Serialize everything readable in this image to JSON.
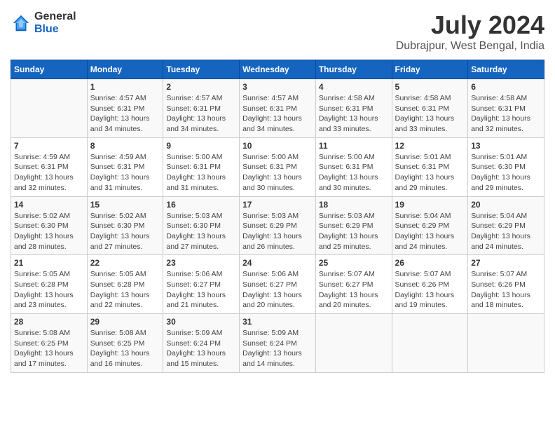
{
  "logo": {
    "general": "General",
    "blue": "Blue"
  },
  "title": "July 2024",
  "subtitle": "Dubrajpur, West Bengal, India",
  "weekdays": [
    "Sunday",
    "Monday",
    "Tuesday",
    "Wednesday",
    "Thursday",
    "Friday",
    "Saturday"
  ],
  "weeks": [
    [
      {
        "day": "",
        "info": ""
      },
      {
        "day": "1",
        "info": "Sunrise: 4:57 AM\nSunset: 6:31 PM\nDaylight: 13 hours\nand 34 minutes."
      },
      {
        "day": "2",
        "info": "Sunrise: 4:57 AM\nSunset: 6:31 PM\nDaylight: 13 hours\nand 34 minutes."
      },
      {
        "day": "3",
        "info": "Sunrise: 4:57 AM\nSunset: 6:31 PM\nDaylight: 13 hours\nand 34 minutes."
      },
      {
        "day": "4",
        "info": "Sunrise: 4:58 AM\nSunset: 6:31 PM\nDaylight: 13 hours\nand 33 minutes."
      },
      {
        "day": "5",
        "info": "Sunrise: 4:58 AM\nSunset: 6:31 PM\nDaylight: 13 hours\nand 33 minutes."
      },
      {
        "day": "6",
        "info": "Sunrise: 4:58 AM\nSunset: 6:31 PM\nDaylight: 13 hours\nand 32 minutes."
      }
    ],
    [
      {
        "day": "7",
        "info": "Sunrise: 4:59 AM\nSunset: 6:31 PM\nDaylight: 13 hours\nand 32 minutes."
      },
      {
        "day": "8",
        "info": "Sunrise: 4:59 AM\nSunset: 6:31 PM\nDaylight: 13 hours\nand 31 minutes."
      },
      {
        "day": "9",
        "info": "Sunrise: 5:00 AM\nSunset: 6:31 PM\nDaylight: 13 hours\nand 31 minutes."
      },
      {
        "day": "10",
        "info": "Sunrise: 5:00 AM\nSunset: 6:31 PM\nDaylight: 13 hours\nand 30 minutes."
      },
      {
        "day": "11",
        "info": "Sunrise: 5:00 AM\nSunset: 6:31 PM\nDaylight: 13 hours\nand 30 minutes."
      },
      {
        "day": "12",
        "info": "Sunrise: 5:01 AM\nSunset: 6:31 PM\nDaylight: 13 hours\nand 29 minutes."
      },
      {
        "day": "13",
        "info": "Sunrise: 5:01 AM\nSunset: 6:30 PM\nDaylight: 13 hours\nand 29 minutes."
      }
    ],
    [
      {
        "day": "14",
        "info": "Sunrise: 5:02 AM\nSunset: 6:30 PM\nDaylight: 13 hours\nand 28 minutes."
      },
      {
        "day": "15",
        "info": "Sunrise: 5:02 AM\nSunset: 6:30 PM\nDaylight: 13 hours\nand 27 minutes."
      },
      {
        "day": "16",
        "info": "Sunrise: 5:03 AM\nSunset: 6:30 PM\nDaylight: 13 hours\nand 27 minutes."
      },
      {
        "day": "17",
        "info": "Sunrise: 5:03 AM\nSunset: 6:29 PM\nDaylight: 13 hours\nand 26 minutes."
      },
      {
        "day": "18",
        "info": "Sunrise: 5:03 AM\nSunset: 6:29 PM\nDaylight: 13 hours\nand 25 minutes."
      },
      {
        "day": "19",
        "info": "Sunrise: 5:04 AM\nSunset: 6:29 PM\nDaylight: 13 hours\nand 24 minutes."
      },
      {
        "day": "20",
        "info": "Sunrise: 5:04 AM\nSunset: 6:29 PM\nDaylight: 13 hours\nand 24 minutes."
      }
    ],
    [
      {
        "day": "21",
        "info": "Sunrise: 5:05 AM\nSunset: 6:28 PM\nDaylight: 13 hours\nand 23 minutes."
      },
      {
        "day": "22",
        "info": "Sunrise: 5:05 AM\nSunset: 6:28 PM\nDaylight: 13 hours\nand 22 minutes."
      },
      {
        "day": "23",
        "info": "Sunrise: 5:06 AM\nSunset: 6:27 PM\nDaylight: 13 hours\nand 21 minutes."
      },
      {
        "day": "24",
        "info": "Sunrise: 5:06 AM\nSunset: 6:27 PM\nDaylight: 13 hours\nand 20 minutes."
      },
      {
        "day": "25",
        "info": "Sunrise: 5:07 AM\nSunset: 6:27 PM\nDaylight: 13 hours\nand 20 minutes."
      },
      {
        "day": "26",
        "info": "Sunrise: 5:07 AM\nSunset: 6:26 PM\nDaylight: 13 hours\nand 19 minutes."
      },
      {
        "day": "27",
        "info": "Sunrise: 5:07 AM\nSunset: 6:26 PM\nDaylight: 13 hours\nand 18 minutes."
      }
    ],
    [
      {
        "day": "28",
        "info": "Sunrise: 5:08 AM\nSunset: 6:25 PM\nDaylight: 13 hours\nand 17 minutes."
      },
      {
        "day": "29",
        "info": "Sunrise: 5:08 AM\nSunset: 6:25 PM\nDaylight: 13 hours\nand 16 minutes."
      },
      {
        "day": "30",
        "info": "Sunrise: 5:09 AM\nSunset: 6:24 PM\nDaylight: 13 hours\nand 15 minutes."
      },
      {
        "day": "31",
        "info": "Sunrise: 5:09 AM\nSunset: 6:24 PM\nDaylight: 13 hours\nand 14 minutes."
      },
      {
        "day": "",
        "info": ""
      },
      {
        "day": "",
        "info": ""
      },
      {
        "day": "",
        "info": ""
      }
    ]
  ]
}
